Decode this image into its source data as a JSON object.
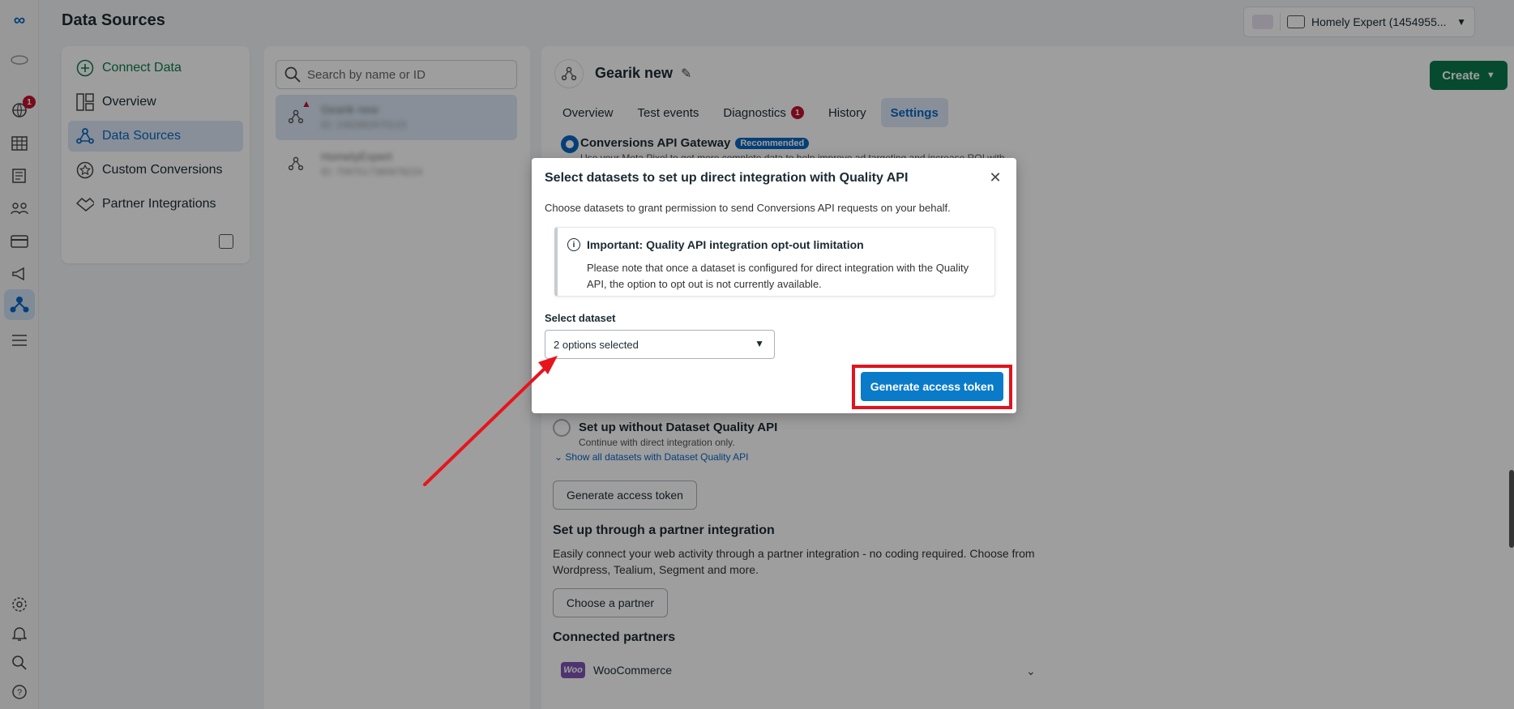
{
  "header": {
    "page_title": "Data Sources",
    "account_name": "Homely Expert (1454955..."
  },
  "rail": {
    "icons": [
      "meta-logo-icon",
      "org-icon",
      "globe-icon",
      "table-icon",
      "catalog-icon",
      "people-icon",
      "billing-icon",
      "megaphone-icon",
      "data-sources-icon",
      "menu-icon",
      "settings-icon",
      "bell-icon",
      "search-icon",
      "help-icon"
    ],
    "notification_count": "1"
  },
  "leftnav": {
    "items": [
      {
        "label": "Connect Data",
        "icon": "plus-circle-icon"
      },
      {
        "label": "Overview",
        "icon": "overview-icon"
      },
      {
        "label": "Data Sources",
        "icon": "data-sources-icon"
      },
      {
        "label": "Custom Conversions",
        "icon": "star-icon"
      },
      {
        "label": "Partner Integrations",
        "icon": "handshake-icon"
      }
    ]
  },
  "list": {
    "search_placeholder": "Search by name or ID",
    "items": [
      {
        "name": "Gearik new",
        "id": "ID: 1082882670123"
      },
      {
        "name": "HomelyExpert",
        "id": "ID: 7097517380878224"
      }
    ]
  },
  "main": {
    "dataset_title": "Gearik new",
    "create_label": "Create",
    "tabs": [
      {
        "label": "Overview"
      },
      {
        "label": "Test events"
      },
      {
        "label": "Diagnostics",
        "badge": "1"
      },
      {
        "label": "History"
      },
      {
        "label": "Settings"
      }
    ],
    "option_gateway": {
      "title": "Conversions API Gateway",
      "badge": "Recommended",
      "sub": "Use your Meta Pixel to get more complete data to help improve ad targeting and increase ROI with"
    },
    "option_without": {
      "title": "Set up without Dataset Quality API",
      "sub": "Continue with direct integration only."
    },
    "show_all_link": "Show all datasets with Dataset Quality API",
    "generate_token_label": "Generate access token",
    "partner_section": {
      "title": "Set up through a partner integration",
      "text": "Easily connect your web activity through a partner integration - no coding required. Choose from Wordpress, Tealium, Segment and more.",
      "button": "Choose a partner"
    },
    "connected_partners": {
      "title": "Connected partners",
      "items": [
        {
          "name": "WooCommerce",
          "logo": "Woo"
        }
      ]
    }
  },
  "modal": {
    "title": "Select datasets to set up direct integration with Quality API",
    "description": "Choose datasets to grant permission to send Conversions API requests on your behalf.",
    "notice_title": "Important: Quality API integration opt-out limitation",
    "notice_body": "Please note that once a dataset is configured for direct integration with the Quality API, the option to opt out is not currently available.",
    "select_label": "Select dataset",
    "select_value": "2 options selected",
    "primary_button": "Generate access token",
    "accent_color": "#0a7bc8",
    "highlight_color": "#e0141e"
  }
}
